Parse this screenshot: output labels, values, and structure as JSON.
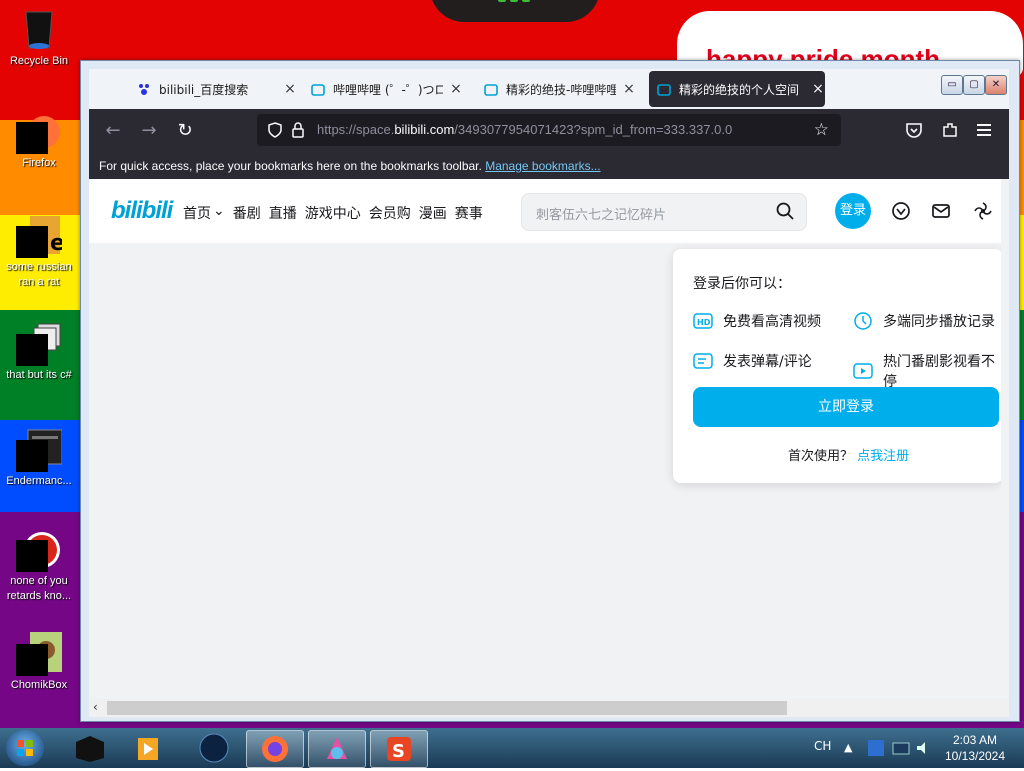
{
  "desktop": {
    "banner_text": "happy pride month",
    "icons": [
      {
        "label": "Recycle Bin"
      },
      {
        "label": "Firefox"
      },
      {
        "label": "some russian ran a rat"
      },
      {
        "label": "that but its c#"
      },
      {
        "label": "Endermanc..."
      },
      {
        "label": "none of you retards kno..."
      },
      {
        "label": "ChomikBox"
      }
    ]
  },
  "browser": {
    "tabs": [
      {
        "title": "bilibili_百度搜索",
        "close": "×"
      },
      {
        "title": "哔哩哔哩 (゜-゜)つロ",
        "close": "×"
      },
      {
        "title": "精彩的绝技-哔哩哔哩",
        "close": "×"
      },
      {
        "title": "精彩的绝技的个人空间",
        "close": "×"
      }
    ],
    "window_controls": {
      "min": "▭",
      "max": "▢",
      "close": "✕"
    },
    "url": {
      "prefix": "https://space.",
      "domain": "bilibili.com",
      "suffix": "/3493077954071423?spm_id_from=333.337.0.0"
    },
    "bookmarks_text": "For quick access, place your bookmarks here on the bookmarks toolbar.",
    "bookmarks_link": "Manage bookmarks...",
    "nav": {
      "back": "←",
      "forward": "→",
      "reload": "↻"
    }
  },
  "site": {
    "logo": "bilibili",
    "nav_items": [
      "首页",
      "番剧",
      "直播",
      "游戏中心",
      "会员购",
      "漫画",
      "赛事"
    ],
    "search_placeholder": "刺客伍六七之记忆碎片",
    "login_label": "登录",
    "popup": {
      "heading": "登录后你可以：",
      "features": [
        "免费看高清视频",
        "多端同步播放记录",
        "发表弹幕/评论",
        "热门番剧影视看不停"
      ],
      "button": "立即登录",
      "first_use": "首次使用？",
      "register": "点我注册"
    }
  },
  "taskbar": {
    "lang": "CH",
    "time": "2:03 AM",
    "date": "10/13/2024"
  },
  "colors": {
    "accent": "#00aeec",
    "firefox_dark": "#2b2a33",
    "bili_blue": "#00a1d6"
  }
}
